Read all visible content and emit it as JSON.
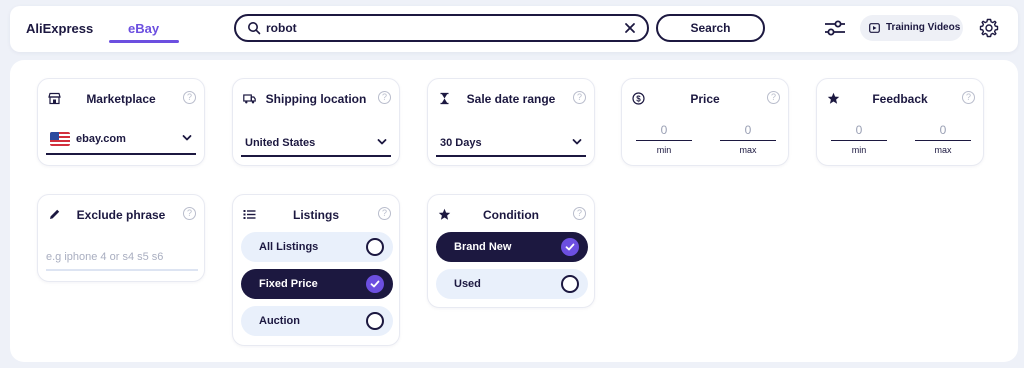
{
  "header": {
    "tabs": [
      {
        "label": "AliExpress"
      },
      {
        "label": "eBay"
      }
    ],
    "search_value": "robot",
    "search_button": "Search",
    "training_label": "Training Videos",
    "accent_color": "#6c4fe0",
    "primary_color": "#1c1840"
  },
  "filters": {
    "marketplace": {
      "title": "Marketplace",
      "value": "ebay.com",
      "flag": "us-flag"
    },
    "shipping": {
      "title": "Shipping location",
      "value": "United States"
    },
    "sale_date": {
      "title": "Sale date range",
      "value": "30 Days"
    },
    "price": {
      "title": "Price",
      "min_value": "0",
      "max_value": "0",
      "min_label": "min",
      "max_label": "max"
    },
    "feedback": {
      "title": "Feedback",
      "min_value": "0",
      "max_value": "0",
      "min_label": "min",
      "max_label": "max"
    },
    "exclude": {
      "title": "Exclude phrase",
      "placeholder": "e.g iphone 4 or s4 s5 s6"
    },
    "listings": {
      "title": "Listings",
      "options": [
        {
          "label": "All Listings",
          "selected": false
        },
        {
          "label": "Fixed Price",
          "selected": true
        },
        {
          "label": "Auction",
          "selected": false
        }
      ]
    },
    "condition": {
      "title": "Condition",
      "options": [
        {
          "label": "Brand New",
          "selected": true
        },
        {
          "label": "Used",
          "selected": false
        }
      ]
    }
  },
  "help_glyph": "?"
}
